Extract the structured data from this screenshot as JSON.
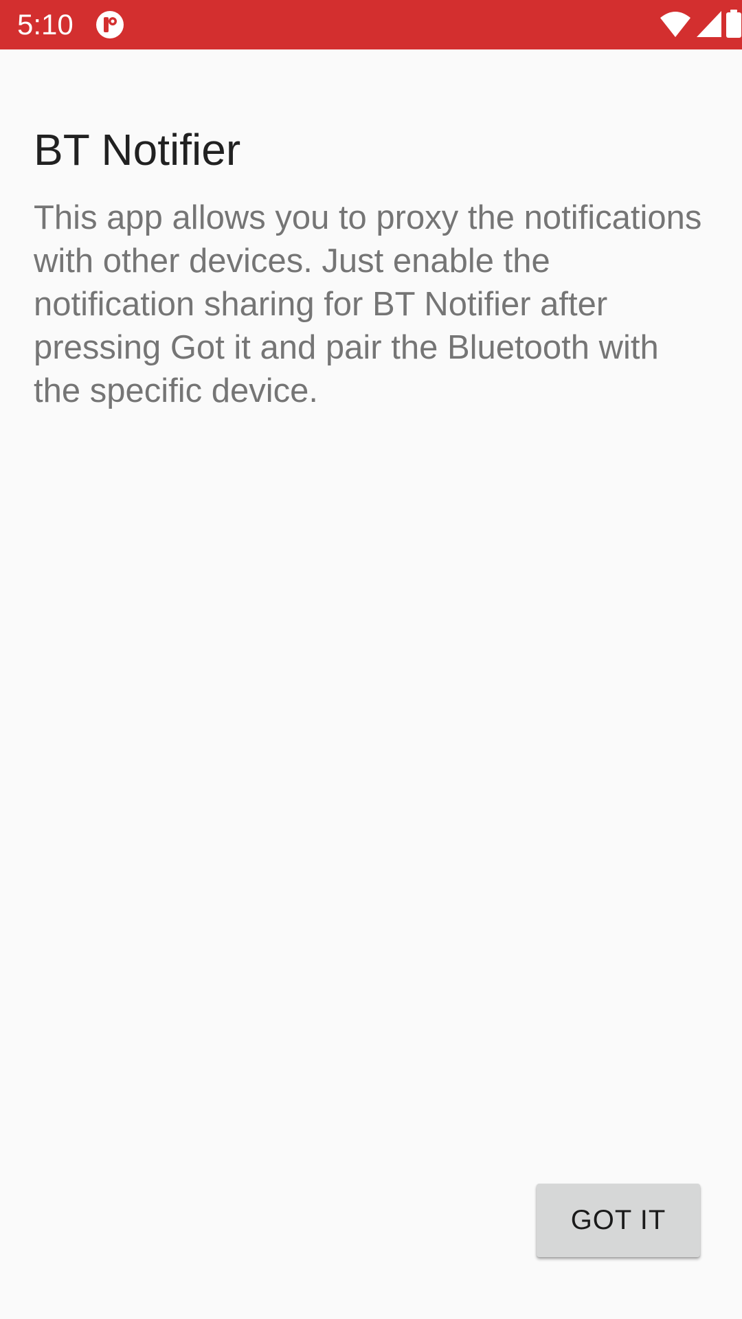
{
  "status_bar": {
    "time": "5:10",
    "background_color": "#d32f2f",
    "icons": [
      "app-notification-icon",
      "wifi-icon",
      "cellular-signal-icon",
      "battery-icon"
    ]
  },
  "main": {
    "title": "BT Notifier",
    "description": "This app allows you to proxy the notifications with other devices. Just enable the notification sharing for BT Notifier after pressing Got it and pair the Bluetooth with the specific device."
  },
  "actions": {
    "got_it_label": "GOT IT"
  }
}
